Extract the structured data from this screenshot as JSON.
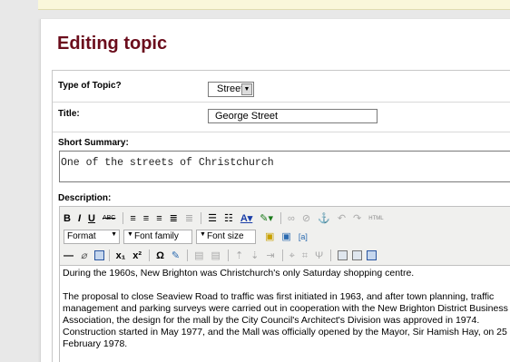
{
  "page": {
    "title": "Editing topic"
  },
  "form": {
    "type_label": "Type of Topic?",
    "type_value": "Street",
    "title_label": "Title:",
    "title_value": "George Street",
    "summary_label": "Short Summary:",
    "summary_value": "One of the streets of Christchurch",
    "description_label": "Description:"
  },
  "editor": {
    "toolbar1": {
      "bold": "B",
      "italic": "I",
      "underline": "U",
      "strike": "ABC",
      "html": "HTML"
    },
    "toolbar2": {
      "format": "Format",
      "font_family": "Font family",
      "font_size": "Font size"
    },
    "toolbar3": {
      "subscript": "x₁",
      "superscript": "x²",
      "omega": "Ω"
    },
    "paragraphs": [
      "During the 1960s, New Brighton was Christchurch's only Saturday shopping centre.",
      "The proposal to close Seaview Road to traffic was first initiated in 1963, and after town planning, traffic management and parking surveys were carried out in cooperation with the New Brighton District Business Association, the design for the mall by the City Council's Architect's Division was approved in 1974. Construction started in May 1977, and the Mall was officially opened by the Mayor, Sir Hamish Hay, on 25 February 1978."
    ]
  },
  "colors": {
    "title": "#6b0d1c",
    "topbar": "#faf7da",
    "background": "#e8e8e8"
  }
}
